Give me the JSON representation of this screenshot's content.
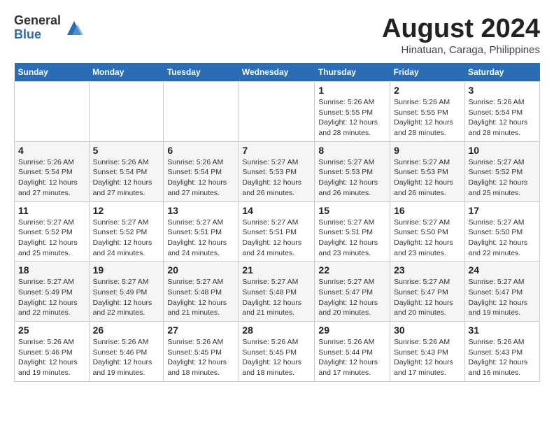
{
  "header": {
    "logo_general": "General",
    "logo_blue": "Blue",
    "month_year": "August 2024",
    "location": "Hinatuan, Caraga, Philippines"
  },
  "weekdays": [
    "Sunday",
    "Monday",
    "Tuesday",
    "Wednesday",
    "Thursday",
    "Friday",
    "Saturday"
  ],
  "weeks": [
    [
      {
        "day": "",
        "detail": ""
      },
      {
        "day": "",
        "detail": ""
      },
      {
        "day": "",
        "detail": ""
      },
      {
        "day": "",
        "detail": ""
      },
      {
        "day": "1",
        "detail": "Sunrise: 5:26 AM\nSunset: 5:55 PM\nDaylight: 12 hours\nand 28 minutes."
      },
      {
        "day": "2",
        "detail": "Sunrise: 5:26 AM\nSunset: 5:55 PM\nDaylight: 12 hours\nand 28 minutes."
      },
      {
        "day": "3",
        "detail": "Sunrise: 5:26 AM\nSunset: 5:54 PM\nDaylight: 12 hours\nand 28 minutes."
      }
    ],
    [
      {
        "day": "4",
        "detail": "Sunrise: 5:26 AM\nSunset: 5:54 PM\nDaylight: 12 hours\nand 27 minutes."
      },
      {
        "day": "5",
        "detail": "Sunrise: 5:26 AM\nSunset: 5:54 PM\nDaylight: 12 hours\nand 27 minutes."
      },
      {
        "day": "6",
        "detail": "Sunrise: 5:26 AM\nSunset: 5:54 PM\nDaylight: 12 hours\nand 27 minutes."
      },
      {
        "day": "7",
        "detail": "Sunrise: 5:27 AM\nSunset: 5:53 PM\nDaylight: 12 hours\nand 26 minutes."
      },
      {
        "day": "8",
        "detail": "Sunrise: 5:27 AM\nSunset: 5:53 PM\nDaylight: 12 hours\nand 26 minutes."
      },
      {
        "day": "9",
        "detail": "Sunrise: 5:27 AM\nSunset: 5:53 PM\nDaylight: 12 hours\nand 26 minutes."
      },
      {
        "day": "10",
        "detail": "Sunrise: 5:27 AM\nSunset: 5:52 PM\nDaylight: 12 hours\nand 25 minutes."
      }
    ],
    [
      {
        "day": "11",
        "detail": "Sunrise: 5:27 AM\nSunset: 5:52 PM\nDaylight: 12 hours\nand 25 minutes."
      },
      {
        "day": "12",
        "detail": "Sunrise: 5:27 AM\nSunset: 5:52 PM\nDaylight: 12 hours\nand 24 minutes."
      },
      {
        "day": "13",
        "detail": "Sunrise: 5:27 AM\nSunset: 5:51 PM\nDaylight: 12 hours\nand 24 minutes."
      },
      {
        "day": "14",
        "detail": "Sunrise: 5:27 AM\nSunset: 5:51 PM\nDaylight: 12 hours\nand 24 minutes."
      },
      {
        "day": "15",
        "detail": "Sunrise: 5:27 AM\nSunset: 5:51 PM\nDaylight: 12 hours\nand 23 minutes."
      },
      {
        "day": "16",
        "detail": "Sunrise: 5:27 AM\nSunset: 5:50 PM\nDaylight: 12 hours\nand 23 minutes."
      },
      {
        "day": "17",
        "detail": "Sunrise: 5:27 AM\nSunset: 5:50 PM\nDaylight: 12 hours\nand 22 minutes."
      }
    ],
    [
      {
        "day": "18",
        "detail": "Sunrise: 5:27 AM\nSunset: 5:49 PM\nDaylight: 12 hours\nand 22 minutes."
      },
      {
        "day": "19",
        "detail": "Sunrise: 5:27 AM\nSunset: 5:49 PM\nDaylight: 12 hours\nand 22 minutes."
      },
      {
        "day": "20",
        "detail": "Sunrise: 5:27 AM\nSunset: 5:48 PM\nDaylight: 12 hours\nand 21 minutes."
      },
      {
        "day": "21",
        "detail": "Sunrise: 5:27 AM\nSunset: 5:48 PM\nDaylight: 12 hours\nand 21 minutes."
      },
      {
        "day": "22",
        "detail": "Sunrise: 5:27 AM\nSunset: 5:47 PM\nDaylight: 12 hours\nand 20 minutes."
      },
      {
        "day": "23",
        "detail": "Sunrise: 5:27 AM\nSunset: 5:47 PM\nDaylight: 12 hours\nand 20 minutes."
      },
      {
        "day": "24",
        "detail": "Sunrise: 5:27 AM\nSunset: 5:47 PM\nDaylight: 12 hours\nand 19 minutes."
      }
    ],
    [
      {
        "day": "25",
        "detail": "Sunrise: 5:26 AM\nSunset: 5:46 PM\nDaylight: 12 hours\nand 19 minutes."
      },
      {
        "day": "26",
        "detail": "Sunrise: 5:26 AM\nSunset: 5:46 PM\nDaylight: 12 hours\nand 19 minutes."
      },
      {
        "day": "27",
        "detail": "Sunrise: 5:26 AM\nSunset: 5:45 PM\nDaylight: 12 hours\nand 18 minutes."
      },
      {
        "day": "28",
        "detail": "Sunrise: 5:26 AM\nSunset: 5:45 PM\nDaylight: 12 hours\nand 18 minutes."
      },
      {
        "day": "29",
        "detail": "Sunrise: 5:26 AM\nSunset: 5:44 PM\nDaylight: 12 hours\nand 17 minutes."
      },
      {
        "day": "30",
        "detail": "Sunrise: 5:26 AM\nSunset: 5:43 PM\nDaylight: 12 hours\nand 17 minutes."
      },
      {
        "day": "31",
        "detail": "Sunrise: 5:26 AM\nSunset: 5:43 PM\nDaylight: 12 hours\nand 16 minutes."
      }
    ]
  ]
}
